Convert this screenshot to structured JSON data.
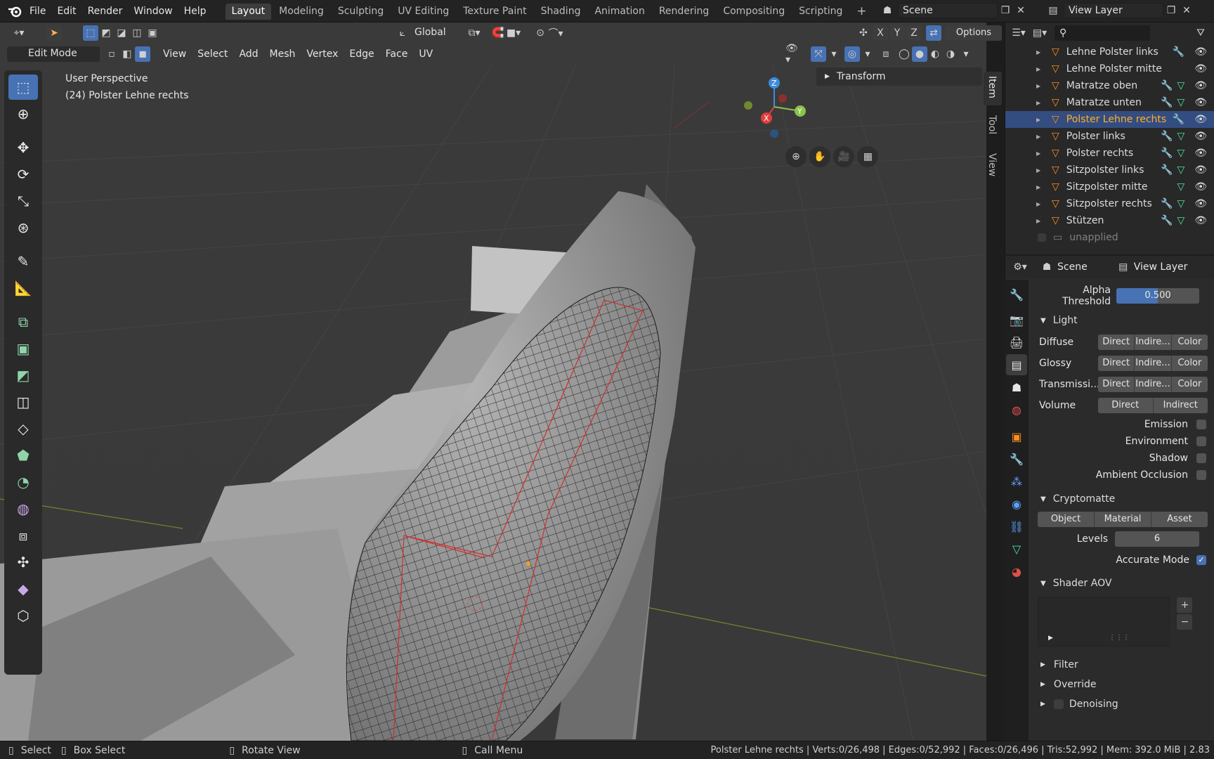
{
  "menu": {
    "file": "File",
    "edit": "Edit",
    "render": "Render",
    "window": "Window",
    "help": "Help"
  },
  "workspaces": [
    "Layout",
    "Modeling",
    "Sculpting",
    "UV Editing",
    "Texture Paint",
    "Shading",
    "Animation",
    "Rendering",
    "Compositing",
    "Scripting"
  ],
  "scene": {
    "label": "Scene",
    "view_layer": "View Layer"
  },
  "header": {
    "orientation": "Global",
    "options": "Options",
    "axes": [
      "X",
      "Y",
      "Z"
    ],
    "mode": "Edit Mode",
    "menus": [
      "View",
      "Select",
      "Add",
      "Mesh",
      "Vertex",
      "Edge",
      "Face",
      "UV"
    ]
  },
  "viewport": {
    "perspective": "User Perspective",
    "object": "(24) Polster Lehne rechts",
    "transform": "Transform",
    "side_tabs": [
      "Item",
      "Tool",
      "View"
    ],
    "gizmo": {
      "x": "X",
      "y": "Y",
      "z": "Z"
    }
  },
  "outliner": {
    "items": [
      {
        "label": "Lehne Polster links",
        "selected": false,
        "modifier": true,
        "mesh": false
      },
      {
        "label": "Lehne Polster mitte",
        "selected": false,
        "modifier": false,
        "mesh": false
      },
      {
        "label": "Matratze oben",
        "selected": false,
        "modifier": true,
        "mesh": true
      },
      {
        "label": "Matratze unten",
        "selected": false,
        "modifier": true,
        "mesh": true
      },
      {
        "label": "Polster Lehne rechts",
        "selected": true,
        "modifier": true,
        "mesh": false
      },
      {
        "label": "Polster links",
        "selected": false,
        "modifier": true,
        "mesh": true
      },
      {
        "label": "Polster rechts",
        "selected": false,
        "modifier": true,
        "mesh": true
      },
      {
        "label": "Sitzpolster links",
        "selected": false,
        "modifier": true,
        "mesh": true
      },
      {
        "label": "Sitzpolster mitte",
        "selected": false,
        "modifier": false,
        "mesh": true
      },
      {
        "label": "Sitzpolster rechts",
        "selected": false,
        "modifier": true,
        "mesh": true
      },
      {
        "label": "Stützen",
        "selected": false,
        "modifier": true,
        "mesh": true
      }
    ],
    "collection": "unapplied"
  },
  "properties": {
    "header": {
      "scene": "Scene",
      "view_layer": "View Layer"
    },
    "alpha_threshold": {
      "label": "Alpha Threshold",
      "value": "0.500",
      "fraction": 0.5
    },
    "light": {
      "title": "Light",
      "rows": [
        {
          "label": "Diffuse",
          "buttons": [
            "Direct",
            "Indire...",
            "Color"
          ]
        },
        {
          "label": "Glossy",
          "buttons": [
            "Direct",
            "Indire...",
            "Color"
          ]
        },
        {
          "label": "Transmissi...",
          "buttons": [
            "Direct",
            "Indire...",
            "Color"
          ]
        },
        {
          "label": "Volume",
          "buttons": [
            "Direct",
            "Indirect"
          ]
        }
      ],
      "checks": [
        {
          "label": "Emission",
          "checked": false
        },
        {
          "label": "Environment",
          "checked": false
        },
        {
          "label": "Shadow",
          "checked": false
        },
        {
          "label": "Ambient Occlusion",
          "checked": false
        }
      ]
    },
    "cryptomatte": {
      "title": "Cryptomatte",
      "buttons": [
        "Object",
        "Material",
        "Asset"
      ],
      "levels_label": "Levels",
      "levels_value": "6",
      "accurate_label": "Accurate Mode",
      "accurate_checked": true
    },
    "shader_aov": {
      "title": "Shader AOV"
    },
    "filter": "Filter",
    "override": "Override",
    "denoising": "Denoising"
  },
  "status": {
    "select": "Select",
    "box_select": "Box Select",
    "rotate": "Rotate View",
    "call_menu": "Call Menu",
    "stats": "Polster Lehne rechts | Verts:0/26,498 | Edges:0/52,992 | Faces:0/26,496 | Tris:52,992 | Mem: 392.0 MiB | 2.83"
  }
}
